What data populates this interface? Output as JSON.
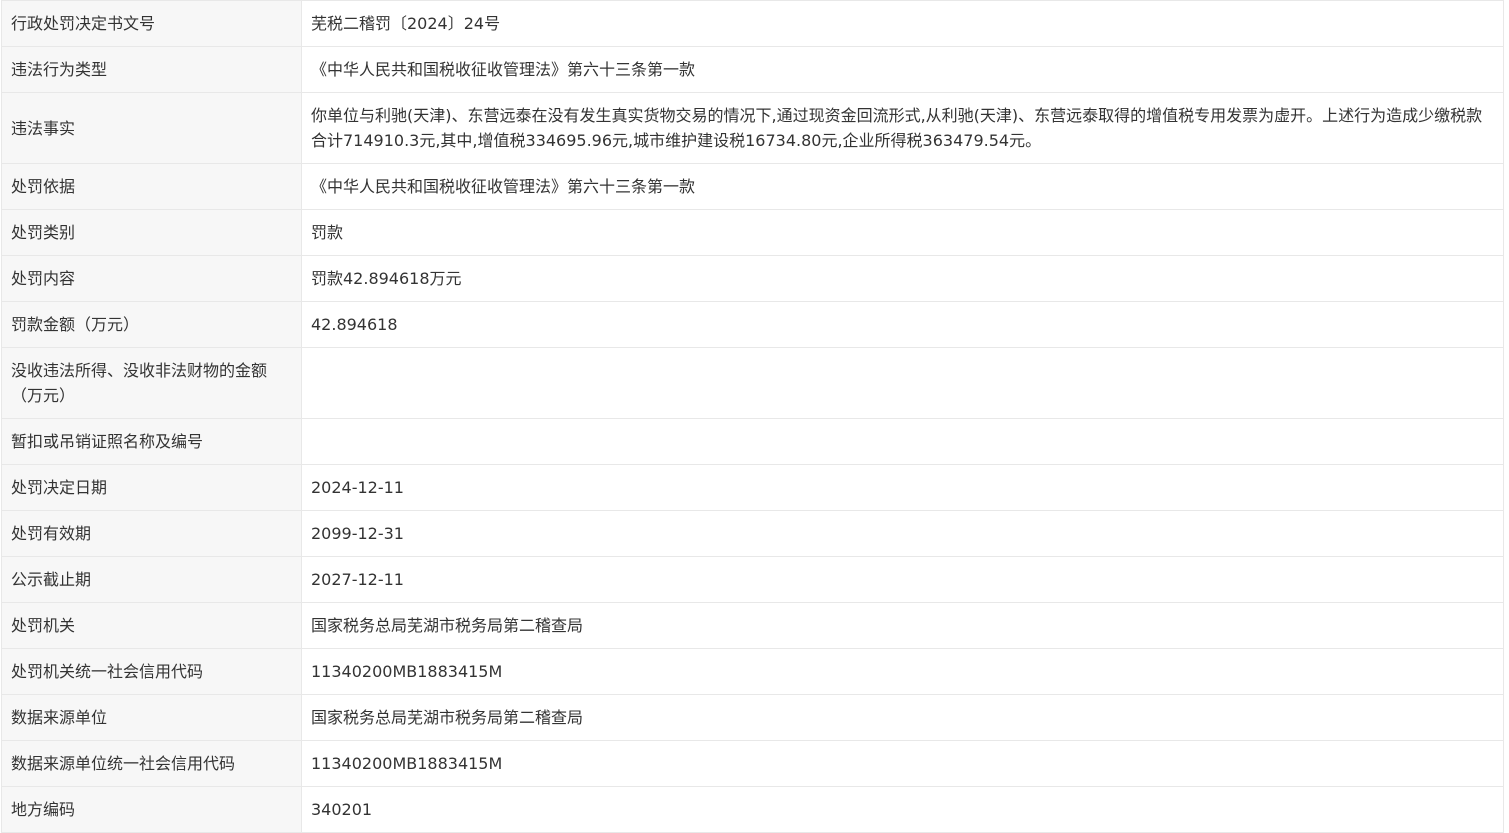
{
  "rows": [
    {
      "label": "行政处罚决定书文号",
      "value": "芜税二稽罚〔2024〕24号"
    },
    {
      "label": "违法行为类型",
      "value": "《中华人民共和国税收征收管理法》第六十三条第一款"
    },
    {
      "label": "违法事实",
      "value": "你单位与利驰(天津)、东营远泰在没有发生真实货物交易的情况下,通过现资金回流形式,从利驰(天津)、东营远泰取得的增值税专用发票为虚开。上述行为造成少缴税款合计714910.3元,其中,增值税334695.96元,城市维护建设税16734.80元,企业所得税363479.54元。"
    },
    {
      "label": "处罚依据",
      "value": "《中华人民共和国税收征收管理法》第六十三条第一款"
    },
    {
      "label": "处罚类别",
      "value": "罚款"
    },
    {
      "label": "处罚内容",
      "value": "罚款42.894618万元"
    },
    {
      "label": "罚款金额（万元）",
      "value": "42.894618"
    },
    {
      "label": "没收违法所得、没收非法财物的金额（万元）",
      "value": ""
    },
    {
      "label": "暂扣或吊销证照名称及编号",
      "value": ""
    },
    {
      "label": "处罚决定日期",
      "value": "2024-12-11"
    },
    {
      "label": "处罚有效期",
      "value": "2099-12-31"
    },
    {
      "label": "公示截止期",
      "value": "2027-12-11"
    },
    {
      "label": "处罚机关",
      "value": "国家税务总局芜湖市税务局第二稽查局"
    },
    {
      "label": "处罚机关统一社会信用代码",
      "value": "11340200MB1883415M"
    },
    {
      "label": "数据来源单位",
      "value": "国家税务总局芜湖市税务局第二稽查局"
    },
    {
      "label": "数据来源单位统一社会信用代码",
      "value": "11340200MB1883415M"
    },
    {
      "label": "地方编码",
      "value": "340201"
    }
  ]
}
